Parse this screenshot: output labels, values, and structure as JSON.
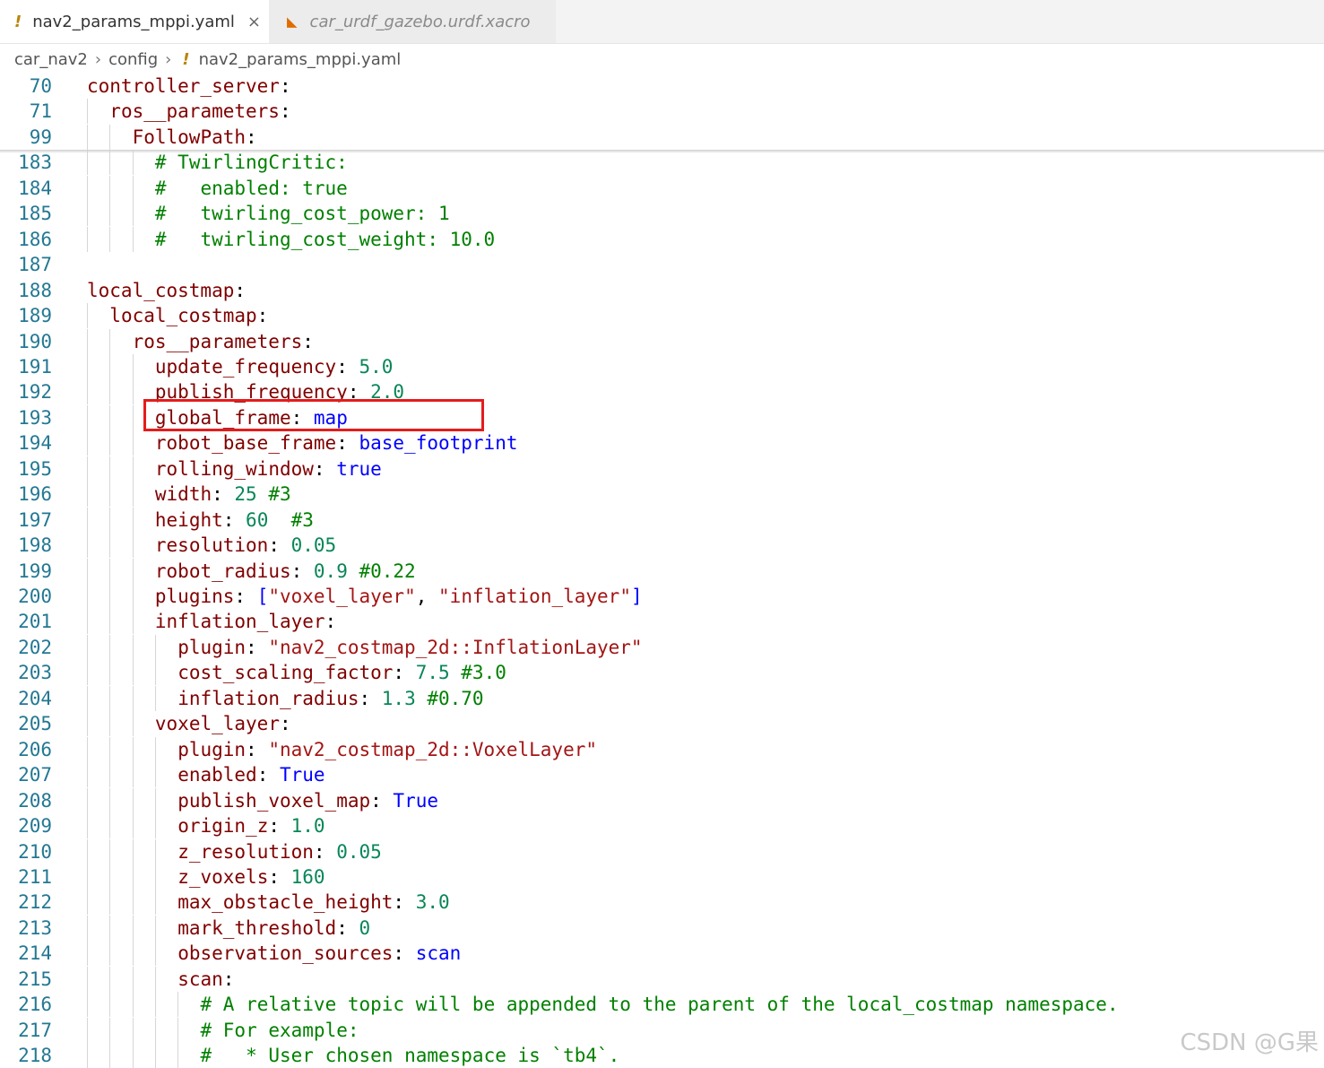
{
  "tabs": [
    {
      "label": "nav2_params_mppi.yaml",
      "icon": "yaml-exclamation-icon",
      "active": true
    },
    {
      "label": "car_urdf_gazebo.urdf.xacro",
      "icon": "rss-icon",
      "active": false
    }
  ],
  "breadcrumb": [
    "car_nav2",
    "config",
    "nav2_params_mppi.yaml"
  ],
  "colors": {
    "key": "#800000",
    "string": "#a31515",
    "keyword": "#0000ff",
    "number": "#098658",
    "comment": "#008000",
    "line_number": "#237893",
    "highlight_box": "#e51c1c"
  },
  "lines": [
    {
      "n": "70",
      "indent": 0,
      "tokens": [
        {
          "t": "controller_server",
          "c": "k"
        },
        {
          "t": ":",
          "c": "p"
        }
      ]
    },
    {
      "n": "71",
      "indent": 1,
      "tokens": [
        {
          "t": "ros__parameters",
          "c": "k"
        },
        {
          "t": ":",
          "c": "p"
        }
      ]
    },
    {
      "n": "99",
      "indent": 2,
      "tokens": [
        {
          "t": "FollowPath",
          "c": "k"
        },
        {
          "t": ":",
          "c": "p"
        }
      ]
    },
    {
      "n": "183",
      "indent": 3,
      "tokens": [
        {
          "t": "# TwirlingCritic:",
          "c": "c"
        }
      ]
    },
    {
      "n": "184",
      "indent": 3,
      "tokens": [
        {
          "t": "#   enabled: true",
          "c": "c"
        }
      ]
    },
    {
      "n": "185",
      "indent": 3,
      "tokens": [
        {
          "t": "#   twirling_cost_power: 1",
          "c": "c"
        }
      ]
    },
    {
      "n": "186",
      "indent": 3,
      "tokens": [
        {
          "t": "#   twirling_cost_weight: 10.0",
          "c": "c"
        }
      ]
    },
    {
      "n": "187",
      "indent": 0,
      "tokens": []
    },
    {
      "n": "188",
      "indent": 0,
      "tokens": [
        {
          "t": "local_costmap",
          "c": "k"
        },
        {
          "t": ":",
          "c": "p"
        }
      ]
    },
    {
      "n": "189",
      "indent": 1,
      "tokens": [
        {
          "t": "local_costmap",
          "c": "k"
        },
        {
          "t": ":",
          "c": "p"
        }
      ]
    },
    {
      "n": "190",
      "indent": 2,
      "tokens": [
        {
          "t": "ros__parameters",
          "c": "k"
        },
        {
          "t": ":",
          "c": "p"
        }
      ]
    },
    {
      "n": "191",
      "indent": 3,
      "tokens": [
        {
          "t": "update_frequency",
          "c": "k"
        },
        {
          "t": ": ",
          "c": "p"
        },
        {
          "t": "5.0",
          "c": "n"
        }
      ]
    },
    {
      "n": "192",
      "indent": 3,
      "tokens": [
        {
          "t": "publish_frequency",
          "c": "k"
        },
        {
          "t": ": ",
          "c": "p"
        },
        {
          "t": "2.0",
          "c": "n"
        }
      ]
    },
    {
      "n": "193",
      "indent": 3,
      "tokens": [
        {
          "t": "global_frame",
          "c": "k"
        },
        {
          "t": ": ",
          "c": "p"
        },
        {
          "t": "map",
          "c": "b"
        }
      ]
    },
    {
      "n": "194",
      "indent": 3,
      "tokens": [
        {
          "t": "robot_base_frame",
          "c": "k"
        },
        {
          "t": ": ",
          "c": "p"
        },
        {
          "t": "base_footprint",
          "c": "b"
        }
      ]
    },
    {
      "n": "195",
      "indent": 3,
      "tokens": [
        {
          "t": "rolling_window",
          "c": "k"
        },
        {
          "t": ": ",
          "c": "p"
        },
        {
          "t": "true",
          "c": "b"
        }
      ]
    },
    {
      "n": "196",
      "indent": 3,
      "tokens": [
        {
          "t": "width",
          "c": "k"
        },
        {
          "t": ": ",
          "c": "p"
        },
        {
          "t": "25",
          "c": "n"
        },
        {
          "t": " #3",
          "c": "c"
        }
      ]
    },
    {
      "n": "197",
      "indent": 3,
      "tokens": [
        {
          "t": "height",
          "c": "k"
        },
        {
          "t": ": ",
          "c": "p"
        },
        {
          "t": "60",
          "c": "n"
        },
        {
          "t": "  #3",
          "c": "c"
        }
      ]
    },
    {
      "n": "198",
      "indent": 3,
      "tokens": [
        {
          "t": "resolution",
          "c": "k"
        },
        {
          "t": ": ",
          "c": "p"
        },
        {
          "t": "0.05",
          "c": "n"
        }
      ]
    },
    {
      "n": "199",
      "indent": 3,
      "tokens": [
        {
          "t": "robot_radius",
          "c": "k"
        },
        {
          "t": ": ",
          "c": "p"
        },
        {
          "t": "0.9",
          "c": "n"
        },
        {
          "t": " #0.22",
          "c": "c"
        }
      ]
    },
    {
      "n": "200",
      "indent": 3,
      "tokens": [
        {
          "t": "plugins",
          "c": "k"
        },
        {
          "t": ": ",
          "c": "p"
        },
        {
          "t": "[",
          "c": "b"
        },
        {
          "t": "\"voxel_layer\"",
          "c": "s"
        },
        {
          "t": ", ",
          "c": "p"
        },
        {
          "t": "\"inflation_layer\"",
          "c": "s"
        },
        {
          "t": "]",
          "c": "b"
        }
      ]
    },
    {
      "n": "201",
      "indent": 3,
      "tokens": [
        {
          "t": "inflation_layer",
          "c": "k"
        },
        {
          "t": ":",
          "c": "p"
        }
      ]
    },
    {
      "n": "202",
      "indent": 4,
      "tokens": [
        {
          "t": "plugin",
          "c": "k"
        },
        {
          "t": ": ",
          "c": "p"
        },
        {
          "t": "\"nav2_costmap_2d::InflationLayer\"",
          "c": "s"
        }
      ]
    },
    {
      "n": "203",
      "indent": 4,
      "tokens": [
        {
          "t": "cost_scaling_factor",
          "c": "k"
        },
        {
          "t": ": ",
          "c": "p"
        },
        {
          "t": "7.5",
          "c": "n"
        },
        {
          "t": " #3.0",
          "c": "c"
        }
      ]
    },
    {
      "n": "204",
      "indent": 4,
      "tokens": [
        {
          "t": "inflation_radius",
          "c": "k"
        },
        {
          "t": ": ",
          "c": "p"
        },
        {
          "t": "1.3",
          "c": "n"
        },
        {
          "t": " #0.70",
          "c": "c"
        }
      ]
    },
    {
      "n": "205",
      "indent": 3,
      "tokens": [
        {
          "t": "voxel_layer",
          "c": "k"
        },
        {
          "t": ":",
          "c": "p"
        }
      ]
    },
    {
      "n": "206",
      "indent": 4,
      "tokens": [
        {
          "t": "plugin",
          "c": "k"
        },
        {
          "t": ": ",
          "c": "p"
        },
        {
          "t": "\"nav2_costmap_2d::VoxelLayer\"",
          "c": "s"
        }
      ]
    },
    {
      "n": "207",
      "indent": 4,
      "tokens": [
        {
          "t": "enabled",
          "c": "k"
        },
        {
          "t": ": ",
          "c": "p"
        },
        {
          "t": "True",
          "c": "b"
        }
      ]
    },
    {
      "n": "208",
      "indent": 4,
      "tokens": [
        {
          "t": "publish_voxel_map",
          "c": "k"
        },
        {
          "t": ": ",
          "c": "p"
        },
        {
          "t": "True",
          "c": "b"
        }
      ]
    },
    {
      "n": "209",
      "indent": 4,
      "tokens": [
        {
          "t": "origin_z",
          "c": "k"
        },
        {
          "t": ": ",
          "c": "p"
        },
        {
          "t": "1.0",
          "c": "n"
        }
      ]
    },
    {
      "n": "210",
      "indent": 4,
      "tokens": [
        {
          "t": "z_resolution",
          "c": "k"
        },
        {
          "t": ": ",
          "c": "p"
        },
        {
          "t": "0.05",
          "c": "n"
        }
      ]
    },
    {
      "n": "211",
      "indent": 4,
      "tokens": [
        {
          "t": "z_voxels",
          "c": "k"
        },
        {
          "t": ": ",
          "c": "p"
        },
        {
          "t": "160",
          "c": "n"
        }
      ]
    },
    {
      "n": "212",
      "indent": 4,
      "tokens": [
        {
          "t": "max_obstacle_height",
          "c": "k"
        },
        {
          "t": ": ",
          "c": "p"
        },
        {
          "t": "3.0",
          "c": "n"
        }
      ]
    },
    {
      "n": "213",
      "indent": 4,
      "tokens": [
        {
          "t": "mark_threshold",
          "c": "k"
        },
        {
          "t": ": ",
          "c": "p"
        },
        {
          "t": "0",
          "c": "n"
        }
      ]
    },
    {
      "n": "214",
      "indent": 4,
      "tokens": [
        {
          "t": "observation_sources",
          "c": "k"
        },
        {
          "t": ": ",
          "c": "p"
        },
        {
          "t": "scan",
          "c": "b"
        }
      ]
    },
    {
      "n": "215",
      "indent": 4,
      "tokens": [
        {
          "t": "scan",
          "c": "k"
        },
        {
          "t": ":",
          "c": "p"
        }
      ]
    },
    {
      "n": "216",
      "indent": 5,
      "tokens": [
        {
          "t": "# A relative topic will be appended to the parent of the local_costmap namespace.",
          "c": "c"
        }
      ]
    },
    {
      "n": "217",
      "indent": 5,
      "tokens": [
        {
          "t": "# For example:",
          "c": "c"
        }
      ]
    },
    {
      "n": "218",
      "indent": 5,
      "tokens": [
        {
          "t": "#   * User chosen namespace is `tb4`.",
          "c": "c"
        }
      ]
    }
  ],
  "highlighted_line": "193",
  "watermark": "CSDN @G果"
}
